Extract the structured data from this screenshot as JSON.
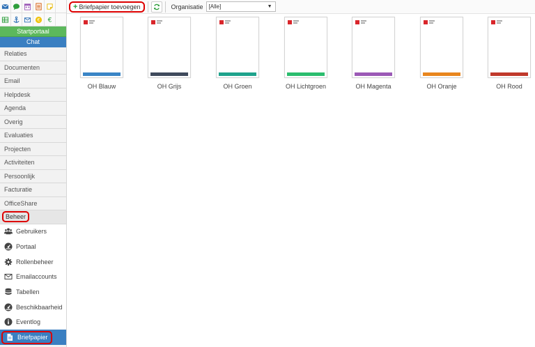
{
  "sidebar": {
    "top_icons_row1": [
      "envelope-icon",
      "chat-bubble-icon",
      "calendar-icon",
      "document-list-icon",
      "sticky-note-icon"
    ],
    "top_icons_row2": [
      "spreadsheet-icon",
      "anchor-icon",
      "mail-icon",
      "euro-coin-icon",
      "euro-icon"
    ],
    "startportaal": "Startportaal",
    "chat": "Chat",
    "menu": [
      "Relaties",
      "Documenten",
      "Email",
      "Helpdesk",
      "Agenda",
      "Overig",
      "Evaluaties",
      "Projecten",
      "Activiteiten",
      "Persoonlijk",
      "Facturatie",
      "OfficeShare"
    ],
    "beheer": "Beheer",
    "sub_items": [
      {
        "label": "Gebruikers",
        "icon": "users-icon"
      },
      {
        "label": "Portaal",
        "icon": "dashboard-icon"
      },
      {
        "label": "Rollenbeheer",
        "icon": "gear-icon"
      },
      {
        "label": "Emailaccounts",
        "icon": "envelope-icon"
      },
      {
        "label": "Tabellen",
        "icon": "database-icon"
      },
      {
        "label": "Beschikbaarheid",
        "icon": "dashboard-icon"
      },
      {
        "label": "Eventlog",
        "icon": "info-icon"
      },
      {
        "label": "Briefpapier",
        "icon": "file-icon"
      }
    ]
  },
  "toolbar": {
    "add_label": "Briefpapier toevoegen",
    "organisatie_label": "Organisatie",
    "organisatie_value": "[Alle]"
  },
  "papers": [
    {
      "name": "OH Blauw",
      "color": "#3a85c6"
    },
    {
      "name": "OH Grijs",
      "color": "#3f4a5c"
    },
    {
      "name": "OH Groen",
      "color": "#1fa38c"
    },
    {
      "name": "OH Lichtgroen",
      "color": "#2bbd6e"
    },
    {
      "name": "OH Magenta",
      "color": "#9b59b6"
    },
    {
      "name": "OH Oranje",
      "color": "#e8861e"
    },
    {
      "name": "OH Rood",
      "color": "#c0392b"
    }
  ]
}
